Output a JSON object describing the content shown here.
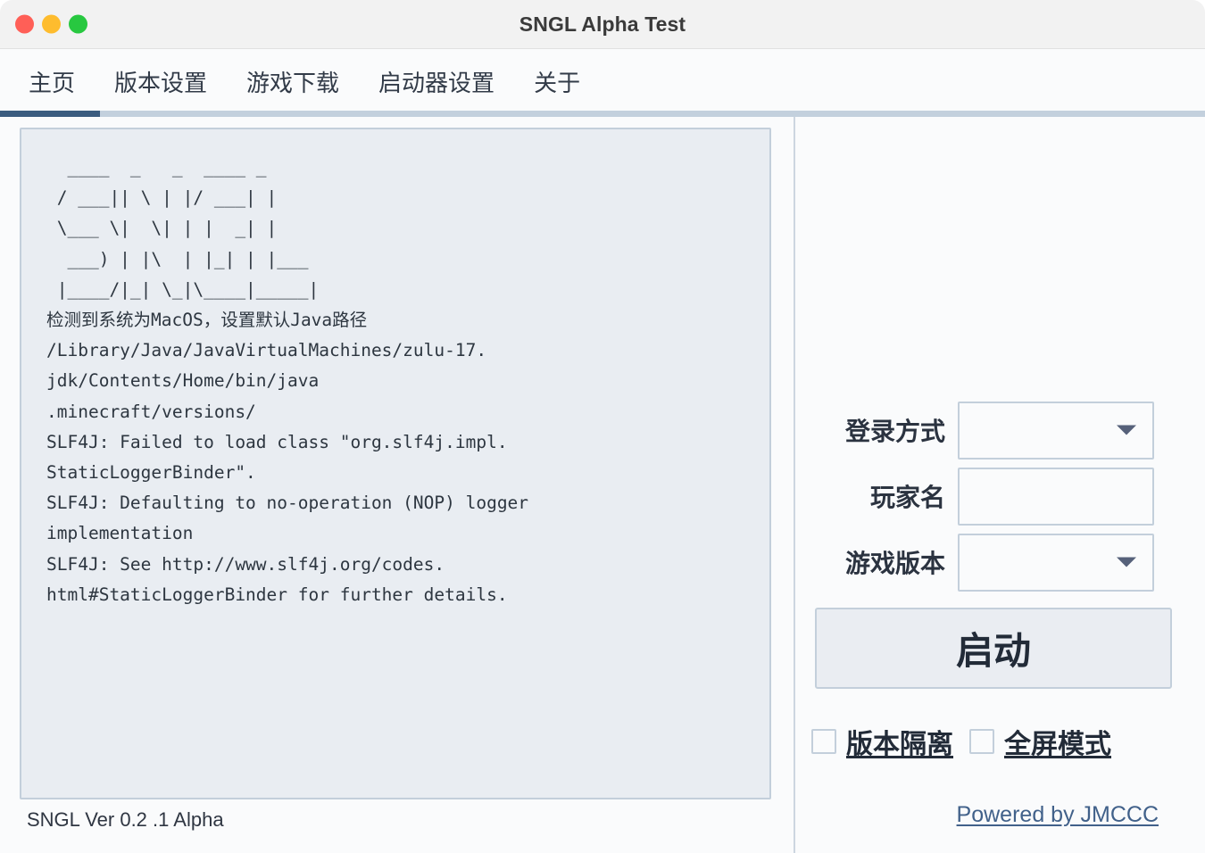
{
  "window": {
    "title": "SNGL Alpha Test",
    "traffic_lights": [
      {
        "name": "close",
        "color": "#ff5f57"
      },
      {
        "name": "minimize",
        "color": "#febc2e"
      },
      {
        "name": "maximize",
        "color": "#28c840"
      }
    ]
  },
  "tabs": [
    {
      "label": "主页",
      "active": true
    },
    {
      "label": "版本设置",
      "active": false
    },
    {
      "label": "游戏下载",
      "active": false
    },
    {
      "label": "启动器设置",
      "active": false
    },
    {
      "label": "关于",
      "active": false
    }
  ],
  "console": {
    "text": "  ____  _   _  ____ _\n / ___|| \\ | |/ ___| |\n \\___ \\|  \\| | |  _| |\n  ___) | |\\  | |_| | |___\n |____/|_| \\_|\\____|_____|\n检测到系统为MacOS，设置默认Java路径\n/Library/Java/JavaVirtualMachines/zulu-17.\njdk/Contents/Home/bin/java\n.minecraft/versions/\nSLF4J: Failed to load class \"org.slf4j.impl.\nStaticLoggerBinder\".\nSLF4J: Defaulting to no-operation (NOP) logger\nimplementation\nSLF4J: See http://www.slf4j.org/codes.\nhtml#StaticLoggerBinder for further details."
  },
  "footer": {
    "version": "SNGL Ver 0.2 .1 Alpha",
    "powered_by": "Powered by JMCCC"
  },
  "form": {
    "login_method": {
      "label": "登录方式",
      "value": "",
      "placeholder": ""
    },
    "player_name": {
      "label": "玩家名",
      "value": "",
      "placeholder": ""
    },
    "game_version": {
      "label": "游戏版本",
      "value": "",
      "placeholder": ""
    }
  },
  "launch_button": {
    "label": "启动"
  },
  "checkboxes": [
    {
      "label": "版本隔离",
      "checked": false
    },
    {
      "label": "全屏模式",
      "checked": false
    }
  ],
  "colors": {
    "accent": "#3b5c7f",
    "tab_rail": "#c3d0dd",
    "panel_bg": "#e9edf2",
    "panel_border": "#c3cfdb",
    "link": "#41618a"
  }
}
